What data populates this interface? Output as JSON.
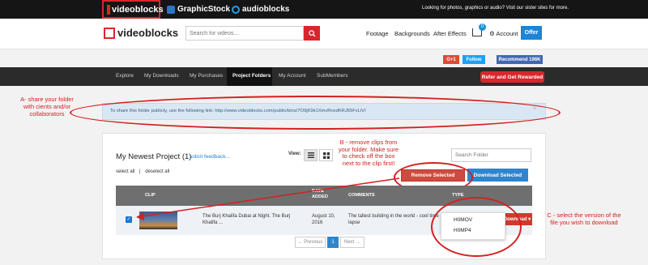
{
  "topbar": {
    "brand": "videoblocks",
    "sister1": "GraphicStock",
    "sister2": "audioblocks",
    "sister_text": "Looking for photos, graphics or audio? Visit our sister sites for more."
  },
  "header": {
    "logo": "videoblocks",
    "search_placeholder": "Search for videos...",
    "nav": [
      "Footage",
      "Backgrounds",
      "After Effects"
    ],
    "cart_count": "0",
    "account": "Account",
    "offer": "Offer"
  },
  "social": {
    "gplus": "G+1",
    "twitter": "Follow",
    "recommend": "Recommend 196K"
  },
  "subnav": {
    "items": [
      "Explore",
      "My Downloads",
      "My Purchases",
      "Project Folders",
      "My Account",
      "SubMembers"
    ],
    "active": "Project Folders",
    "refer": "Refer and Get Rewarded"
  },
  "share": {
    "text": "To share this folder publicly, use the following link: http://www.videoblocks.com/public/bins/7O9jK9k1XmvRnxdKRJ65FvLiV/",
    "close": "×"
  },
  "annotations": {
    "a": "A- share your folder with cients and/or collaborators",
    "b": "B - remove clips from your folder. Make sure to check off the box next to the clip first!",
    "c": "C - select the version of the file you wish to download"
  },
  "project": {
    "title": "My Newest Project",
    "count": "(1)",
    "feedback": "solicit feedback...",
    "select_all": "select all",
    "separator": "|",
    "deselect_all": "deselect all",
    "view_label": "View:",
    "search_folder_placeholder": "Search Folder",
    "remove_selected": "Remove Selected",
    "download_selected": "Download Selected"
  },
  "table": {
    "headers": {
      "clip": "CLIP",
      "date": "DATE\nADDED",
      "comments": "COMMENTS",
      "type": "TYPE"
    },
    "row": {
      "title": "The Burj Khalifa Dubai at Night. The Burj Khalifa ...",
      "date": "August 10, 2016",
      "comment": "The tallest building in the world - cool time lapse",
      "download": "Download ▾"
    },
    "dropdown": [
      "H0MOV",
      "H0MP4"
    ]
  },
  "pagination": {
    "prev": "← Previous",
    "current": "1",
    "next": "Next →"
  }
}
